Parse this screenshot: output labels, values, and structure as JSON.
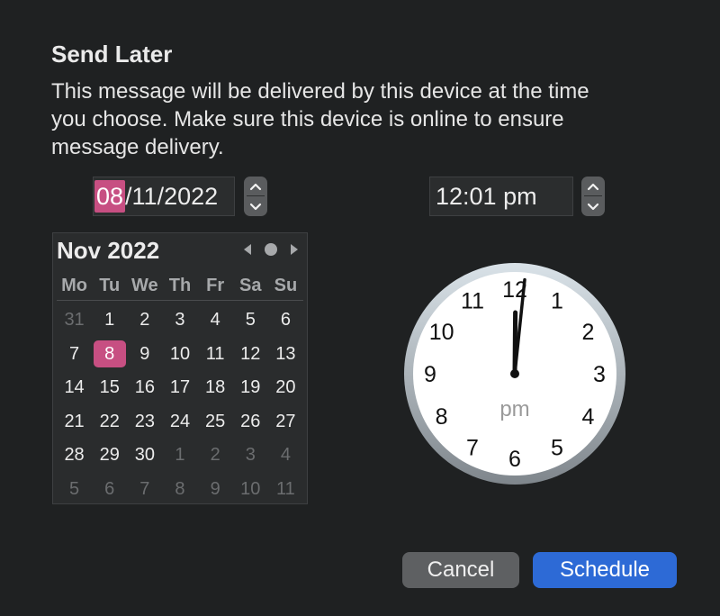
{
  "dialog": {
    "title": "Send Later",
    "message": "This message will be delivered by this device at the time you choose. Make sure this device is online to ensure message delivery."
  },
  "date_field": {
    "day": "08",
    "rest": "/11/2022",
    "stepper_icons": [
      "chevron-up-icon",
      "chevron-down-icon"
    ]
  },
  "time_field": {
    "value": "12:01 pm",
    "stepper_icons": [
      "chevron-up-icon",
      "chevron-down-icon"
    ]
  },
  "calendar": {
    "month_year": "Nov 2022",
    "nav_icons": [
      "previous-month-icon",
      "today-dot-icon",
      "next-month-icon"
    ],
    "weekdays": [
      "Mo",
      "Tu",
      "We",
      "Th",
      "Fr",
      "Sa",
      "Su"
    ],
    "days": [
      {
        "label": "31",
        "muted": true
      },
      {
        "label": "1"
      },
      {
        "label": "2"
      },
      {
        "label": "3"
      },
      {
        "label": "4"
      },
      {
        "label": "5"
      },
      {
        "label": "6"
      },
      {
        "label": "7"
      },
      {
        "label": "8",
        "selected": true
      },
      {
        "label": "9"
      },
      {
        "label": "10"
      },
      {
        "label": "11"
      },
      {
        "label": "12"
      },
      {
        "label": "13"
      },
      {
        "label": "14"
      },
      {
        "label": "15"
      },
      {
        "label": "16"
      },
      {
        "label": "17"
      },
      {
        "label": "18"
      },
      {
        "label": "19"
      },
      {
        "label": "20"
      },
      {
        "label": "21"
      },
      {
        "label": "22"
      },
      {
        "label": "23"
      },
      {
        "label": "24"
      },
      {
        "label": "25"
      },
      {
        "label": "26"
      },
      {
        "label": "27"
      },
      {
        "label": "28"
      },
      {
        "label": "29"
      },
      {
        "label": "30"
      },
      {
        "label": "1",
        "muted": true
      },
      {
        "label": "2",
        "muted": true
      },
      {
        "label": "3",
        "muted": true
      },
      {
        "label": "4",
        "muted": true
      },
      {
        "label": "5",
        "muted": true
      },
      {
        "label": "6",
        "muted": true
      },
      {
        "label": "7",
        "muted": true
      },
      {
        "label": "8",
        "muted": true
      },
      {
        "label": "9",
        "muted": true
      },
      {
        "label": "10",
        "muted": true
      },
      {
        "label": "11",
        "muted": true
      }
    ]
  },
  "clock": {
    "numbers": [
      "12",
      "1",
      "2",
      "3",
      "4",
      "5",
      "6",
      "7",
      "8",
      "9",
      "10",
      "11"
    ],
    "period": "pm",
    "hour": 12,
    "minute": 1
  },
  "buttons": {
    "cancel": "Cancel",
    "schedule": "Schedule"
  },
  "colors": {
    "background": "#1f2122",
    "selection": "#c74f82",
    "primary_button": "#2d6ad6",
    "secondary_button": "#5e6062"
  }
}
